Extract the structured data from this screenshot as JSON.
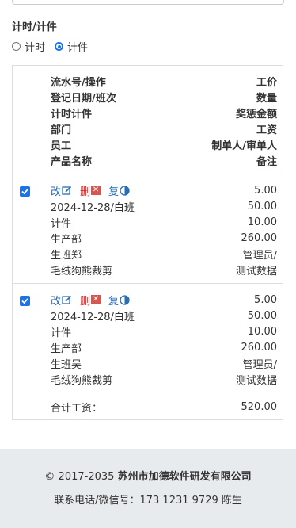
{
  "form": {
    "mode_label": "计时/计件",
    "radio_timed": "计时",
    "radio_piece": "计件",
    "selected": "计件"
  },
  "header": {
    "left": [
      "流水号/操作",
      "登记日期/班次",
      "计时计件",
      "部门",
      "员工",
      "产品名称"
    ],
    "right": [
      "工价",
      "数量",
      "奖惩金额",
      "工资",
      "制单人/审单人",
      "备注"
    ]
  },
  "ops": {
    "edit": "改",
    "delete": "删",
    "copy": "复"
  },
  "records": [
    {
      "checked": true,
      "left": [
        "2024-12-28/白班",
        "计件",
        "生产部",
        "生班郑",
        "毛绒狗熊裁剪"
      ],
      "right": [
        "5.00",
        "50.00",
        "10.00",
        "260.00",
        "管理员/",
        "测试数据"
      ]
    },
    {
      "checked": true,
      "left": [
        "2024-12-28/白班",
        "计件",
        "生产部",
        "生班吴",
        "毛绒狗熊裁剪"
      ],
      "right": [
        "5.00",
        "50.00",
        "10.00",
        "260.00",
        "管理员/",
        "测试数据"
      ]
    }
  ],
  "total": {
    "label": "合计工资：",
    "value": "520.00"
  },
  "footer": {
    "copyright": "© 2017-2035",
    "company": "苏州市加德软件研发有限公司",
    "contact": "联系电话/微信号：173 1231 9729 陈生"
  },
  "colors": {
    "accent": "#1a73e8",
    "link": "#2a6db5",
    "danger": "#d9534f",
    "footer_bg": "#e8ebee"
  }
}
